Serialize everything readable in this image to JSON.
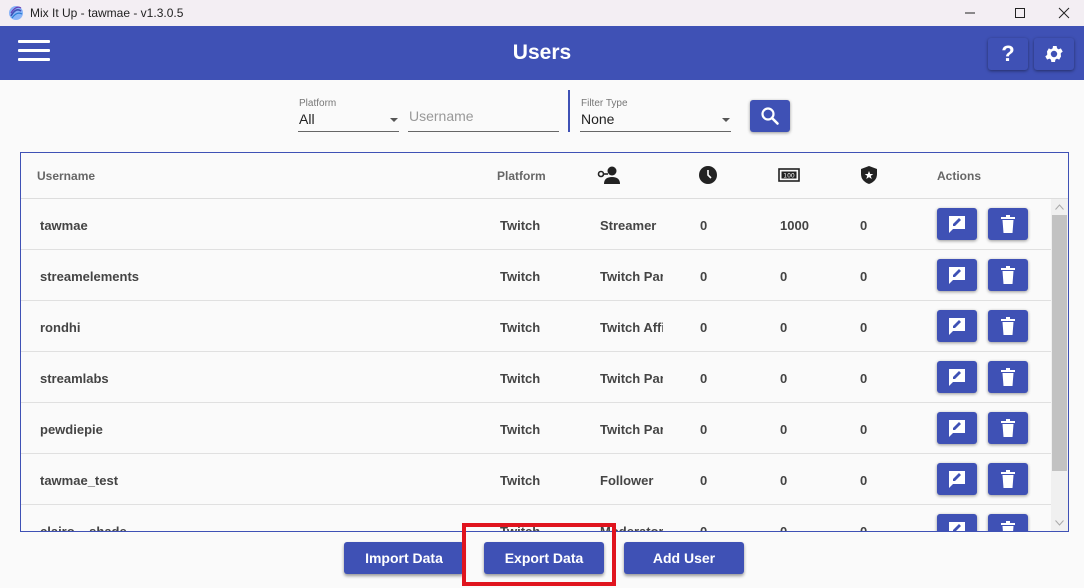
{
  "window": {
    "title": "Mix It Up - tawmae - v1.3.0.5"
  },
  "header": {
    "title": "Users",
    "help_label": "?"
  },
  "filters": {
    "platform_label": "Platform",
    "platform_value": "All",
    "username_placeholder": "Username",
    "filter_type_label": "Filter Type",
    "filter_type_value": "None"
  },
  "table": {
    "columns": {
      "username": "Username",
      "platform": "Platform",
      "role_icon": "user-role-icon",
      "time_icon": "clock-icon",
      "currency_icon": "currency-icon",
      "rank_icon": "shield-star-icon",
      "actions": "Actions"
    },
    "rows": [
      {
        "username": "tawmae",
        "platform": "Twitch",
        "role": "Streamer",
        "time": "0",
        "currency": "1000",
        "rank": "0"
      },
      {
        "username": "streamelements",
        "platform": "Twitch",
        "role": "Twitch Partner",
        "time": "0",
        "currency": "0",
        "rank": "0"
      },
      {
        "username": "rondhi",
        "platform": "Twitch",
        "role": "Twitch Affiliate",
        "time": "0",
        "currency": "0",
        "rank": "0"
      },
      {
        "username": "streamlabs",
        "platform": "Twitch",
        "role": "Twitch Partner",
        "time": "0",
        "currency": "0",
        "rank": "0"
      },
      {
        "username": "pewdiepie",
        "platform": "Twitch",
        "role": "Twitch Partner",
        "time": "0",
        "currency": "0",
        "rank": "0"
      },
      {
        "username": "tawmae_test",
        "platform": "Twitch",
        "role": "Follower",
        "time": "0",
        "currency": "0",
        "rank": "0"
      },
      {
        "username": "clairo__shade",
        "platform": "Twitch",
        "role": "Moderator",
        "time": "0",
        "currency": "0",
        "rank": "0"
      }
    ]
  },
  "actions": {
    "import_label": "Import Data",
    "export_label": "Export Data",
    "add_user_label": "Add User"
  },
  "colors": {
    "primary": "#3f51b5",
    "highlight": "#e0141e"
  }
}
